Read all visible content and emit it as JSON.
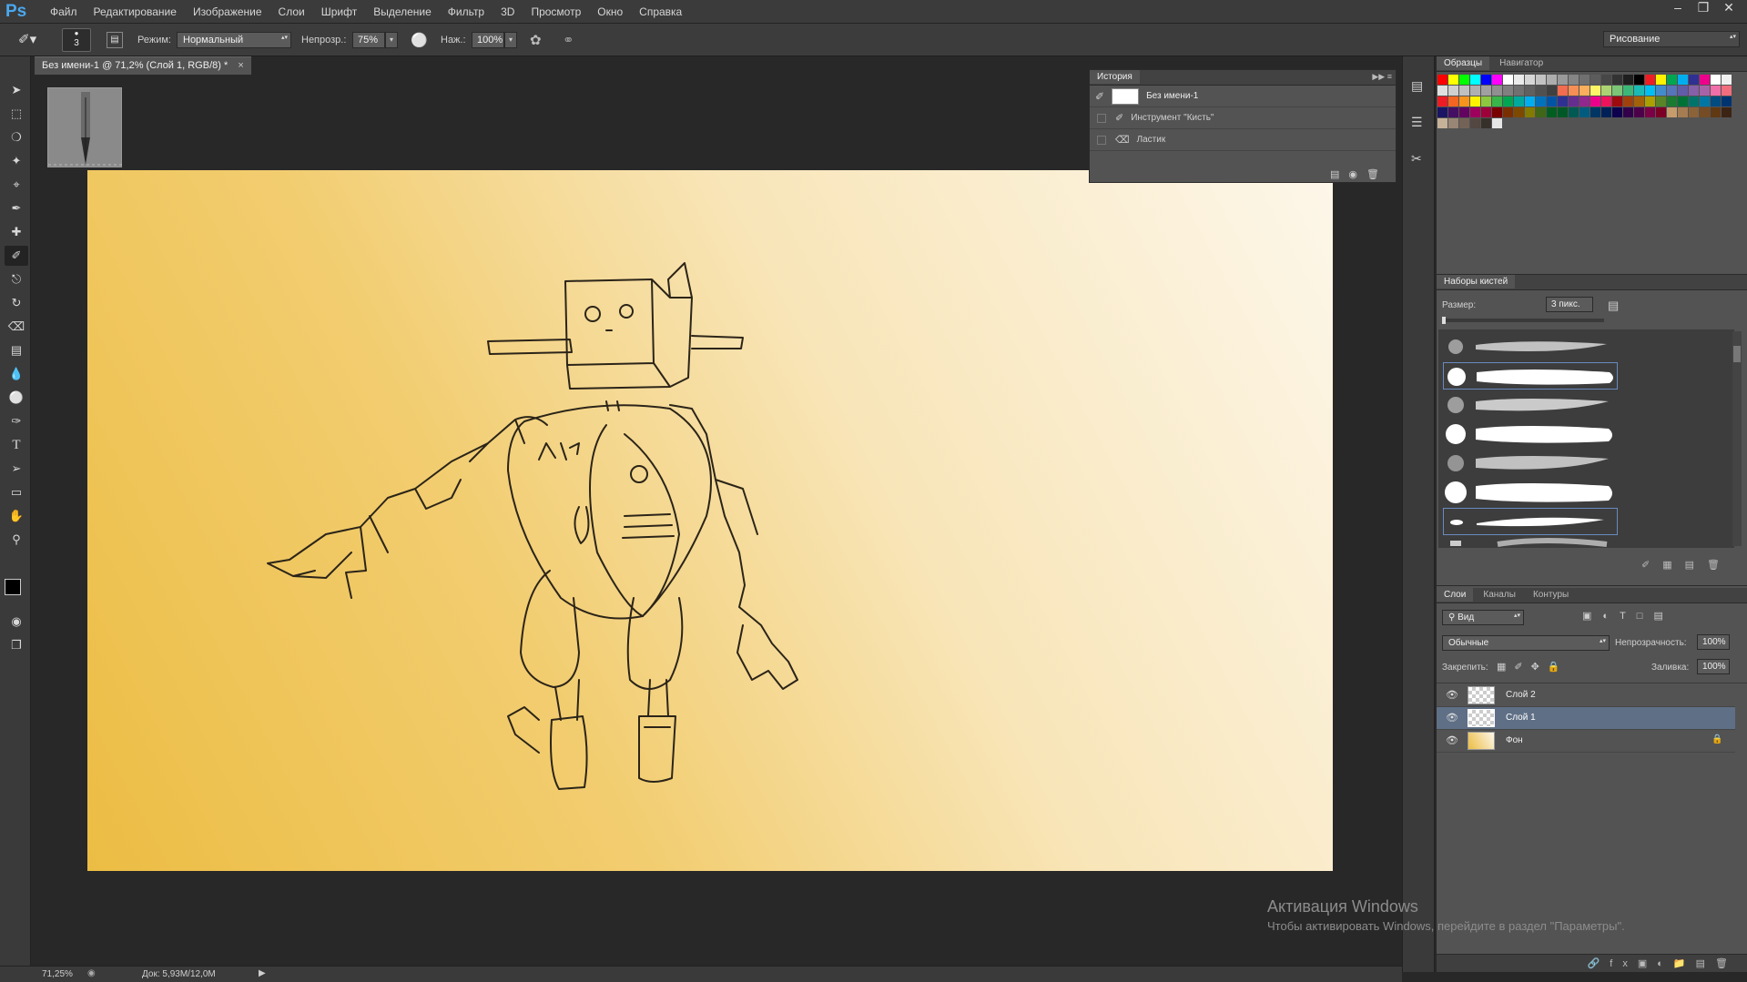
{
  "app": {
    "logo": "Ps"
  },
  "menu": [
    "Файл",
    "Редактирование",
    "Изображение",
    "Слои",
    "Шрифт",
    "Выделение",
    "Фильтр",
    "3D",
    "Просмотр",
    "Окно",
    "Справка"
  ],
  "options": {
    "brush_size": "3",
    "mode_label": "Режим:",
    "mode_value": "Нормальный",
    "opacity_label": "Непрозр.:",
    "opacity_value": "75%",
    "pressure_label": "Наж.:",
    "pressure_value": "100%",
    "workspace": "Рисование"
  },
  "document": {
    "tab_title": "Без имени-1 @ 71,2% (Слой 1, RGB/8) *"
  },
  "history": {
    "tab": "История",
    "snapshot": "Без имени-1",
    "items": [
      "Инструмент \"Кисть\"",
      "Ластик"
    ]
  },
  "swatches_panel": {
    "tab_swatches": "Образцы",
    "tab_navigator": "Навигатор"
  },
  "swatch_colors": [
    "#ff0000",
    "#ffff00",
    "#00ff00",
    "#00ffff",
    "#0000ff",
    "#ff00ff",
    "#ffffff",
    "#ebebeb",
    "#d6d6d6",
    "#c2c2c2",
    "#adadad",
    "#999999",
    "#858585",
    "#707070",
    "#5c5c5c",
    "#474747",
    "#333333",
    "#1f1f1f",
    "#000000",
    "#ee1d24",
    "#fff100",
    "#00a650",
    "#00aeef",
    "#2f3192",
    "#ed008c",
    "#ffffff",
    "#f0f0f0",
    "#e0e0e0",
    "#d0d0d0",
    "#c0c0c0",
    "#b0b0b0",
    "#a0a0a0",
    "#909090",
    "#808080",
    "#707070",
    "#606060",
    "#505050",
    "#404040",
    "#f26c4f",
    "#f68e55",
    "#fbaf5c",
    "#fff467",
    "#acd372",
    "#7cc576",
    "#3bb878",
    "#1abbb4",
    "#00bff3",
    "#438ccb",
    "#5574b9",
    "#605ca8",
    "#855fa8",
    "#a763a8",
    "#f06ea9",
    "#f26d7d",
    "#ed1c24",
    "#f26522",
    "#f7941d",
    "#fff200",
    "#8dc73f",
    "#39b54a",
    "#00a651",
    "#00a99d",
    "#00aeef",
    "#0072bc",
    "#0054a6",
    "#2e3192",
    "#662d91",
    "#92278f",
    "#ec008c",
    "#ed145b",
    "#9e0b0f",
    "#a0410d",
    "#a3620a",
    "#aba000",
    "#598527",
    "#1a7b30",
    "#007236",
    "#00746b",
    "#0076a3",
    "#004b80",
    "#003471",
    "#1b1464",
    "#440e62",
    "#630460",
    "#9e005d",
    "#9e0039",
    "#790000",
    "#7b2e00",
    "#7d4900",
    "#827b00",
    "#406618",
    "#005e20",
    "#005826",
    "#005952",
    "#005b7f",
    "#003663",
    "#002157",
    "#0d004c",
    "#32004b",
    "#4b0049",
    "#7b0046",
    "#7a0026",
    "#c69c6d",
    "#a67c52",
    "#8c6239",
    "#754c24",
    "#603913",
    "#3c2415",
    "#c7b299",
    "#998675",
    "#736357",
    "#534741",
    "#37302a",
    "#e6e6e6"
  ],
  "brushes_panel": {
    "tab": "Наборы кистей",
    "size_label": "Размер:",
    "size_value": "3 пикс."
  },
  "layers_panel": {
    "tabs": [
      "Слои",
      "Каналы",
      "Контуры"
    ],
    "filter": "Вид",
    "blend": "Обычные",
    "opacity_label": "Непрозрачность:",
    "opacity_value": "100%",
    "lock_label": "Закрепить:",
    "fill_label": "Заливка:",
    "fill_value": "100%",
    "layers": [
      {
        "name": "Слой 2",
        "selected": false
      },
      {
        "name": "Слой 1",
        "selected": true
      },
      {
        "name": "Фон",
        "selected": false,
        "locked": true
      }
    ]
  },
  "status": {
    "zoom": "71,25%",
    "doc": "Док: 5,93M/12,0M"
  },
  "watermark": {
    "line1": "Активация Windows",
    "line2": "Чтобы активировать Windows, перейдите в раздел \"Параметры\"."
  }
}
